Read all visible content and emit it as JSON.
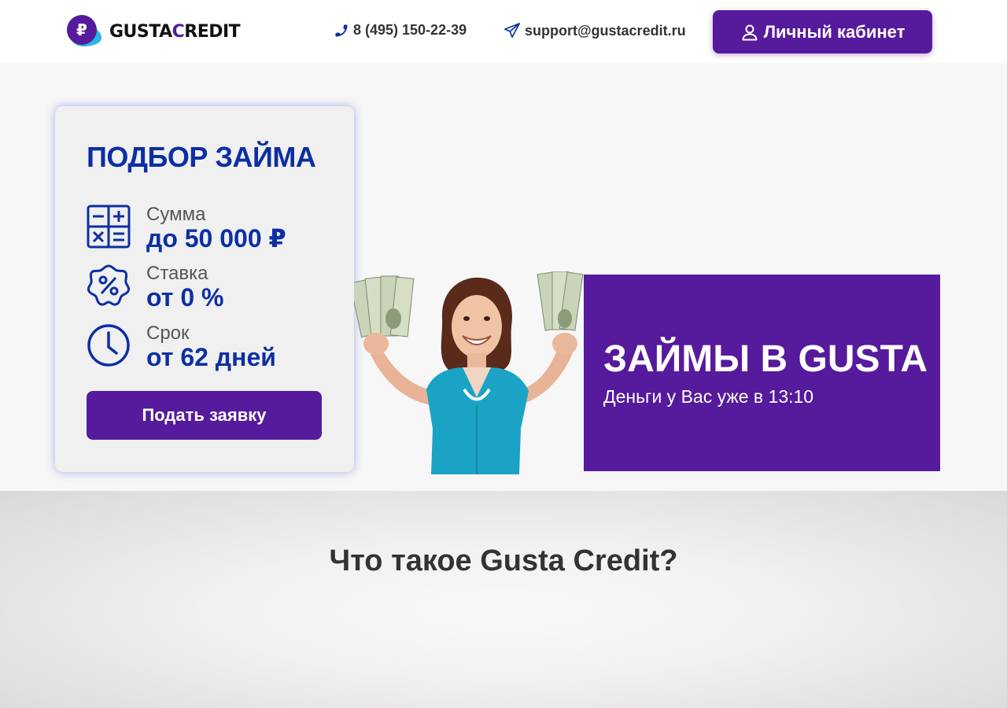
{
  "header": {
    "logo_symbol": "₽",
    "logo_part1": "GUSTA",
    "logo_part2": "C",
    "logo_part3": "REDIT",
    "phone": "8 (495) 150-22-39",
    "email": "support@gustacredit.ru",
    "cabinet_label": "Личный кабинет",
    "phone_icon": "phone-icon",
    "email_icon": "paper-plane-icon",
    "cabinet_icon": "user-icon"
  },
  "loan_card": {
    "title": "ПОДБОР ЗАЙМА",
    "features": [
      {
        "label": "Сумма",
        "value": "до 50 000 ₽",
        "icon": "calculator-icon"
      },
      {
        "label": "Ставка",
        "value": "от 0 %",
        "icon": "percent-badge-icon"
      },
      {
        "label": "Срок",
        "value": "от 62 дней",
        "icon": "clock-icon"
      }
    ],
    "apply_label": "Подать заявку"
  },
  "promo": {
    "title": "ЗАЙМЫ В GUSTA",
    "subtitle": "Деньги у Вас уже в 13:10"
  },
  "about": {
    "title": "Что такое Gusta Credit?"
  },
  "colors": {
    "brand_purple": "#561a9c",
    "accent_blue": "#0d2fa3",
    "logo_cyan": "#29b6e8"
  }
}
